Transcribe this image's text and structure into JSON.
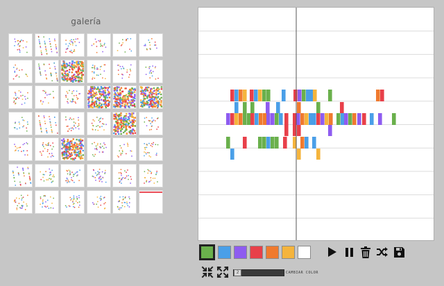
{
  "gallery": {
    "title": "galería",
    "thumbnails": [
      {
        "id": "t11"
      },
      {
        "id": "t12"
      },
      {
        "id": "t13"
      },
      {
        "id": "t14"
      },
      {
        "id": "t15"
      },
      {
        "id": "t16"
      },
      {
        "id": "t21"
      },
      {
        "id": "t22"
      },
      {
        "id": "t23"
      },
      {
        "id": "t24"
      },
      {
        "id": "t25"
      },
      {
        "id": "t26"
      },
      {
        "id": "t31"
      },
      {
        "id": "t32"
      },
      {
        "id": "t33"
      },
      {
        "id": "t34"
      },
      {
        "id": "t35"
      },
      {
        "id": "t36"
      },
      {
        "id": "t41"
      },
      {
        "id": "t42"
      },
      {
        "id": "t43"
      },
      {
        "id": "t44"
      },
      {
        "id": "t45"
      },
      {
        "id": "t46"
      },
      {
        "id": "t51"
      },
      {
        "id": "t52"
      },
      {
        "id": "t53"
      },
      {
        "id": "t54"
      },
      {
        "id": "t55"
      },
      {
        "id": "t56"
      },
      {
        "id": "t61"
      },
      {
        "id": "t62"
      },
      {
        "id": "t63"
      },
      {
        "id": "t64"
      },
      {
        "id": "t65"
      },
      {
        "id": "t66"
      },
      {
        "id": "t71"
      },
      {
        "id": "t72"
      },
      {
        "id": "t73"
      },
      {
        "id": "t74"
      },
      {
        "id": "t75"
      },
      {
        "id": "t76"
      }
    ]
  },
  "palette": {
    "colors": [
      "#6ab04c",
      "#4a9fe8",
      "#8e5cf0",
      "#e8404a",
      "#f07a2e",
      "#f5b43c",
      "#ffffff"
    ],
    "selected_index": 0
  },
  "controls": {
    "icons": [
      "play-icon",
      "pause-icon",
      "trash-icon",
      "shuffle-icon",
      "save-icon"
    ]
  },
  "speed": {
    "value": "2"
  },
  "color_button": {
    "label": "CAMBIAR COLOR"
  },
  "icons": {
    "zoom_in": "zoom-in-icon",
    "zoom_out": "zoom-out-icon"
  }
}
